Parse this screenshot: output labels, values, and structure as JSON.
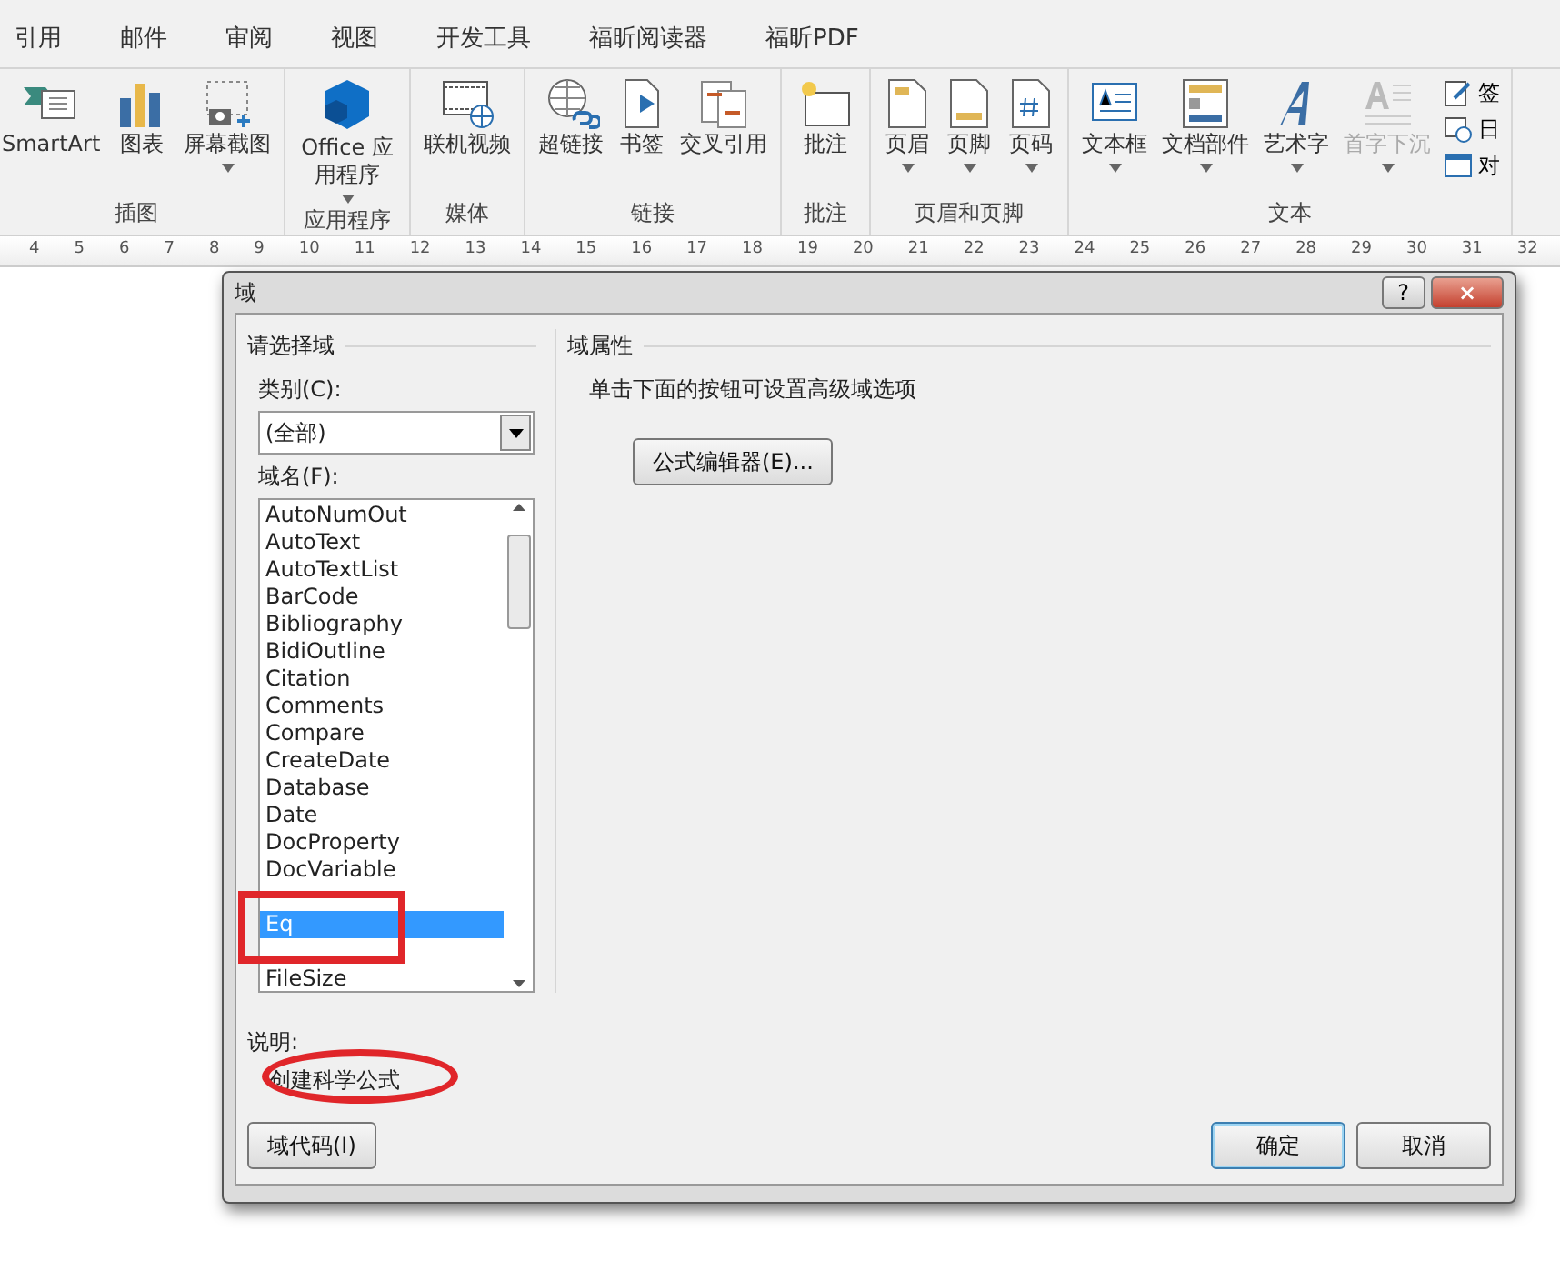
{
  "ribbon": {
    "tabs": [
      {
        "label": "引用",
        "selected": false
      },
      {
        "label": "邮件",
        "selected": false
      },
      {
        "label": "审阅",
        "selected": false
      },
      {
        "label": "视图",
        "selected": false
      },
      {
        "label": "开发工具",
        "selected": false
      },
      {
        "label": "福昕阅读器",
        "selected": false
      },
      {
        "label": "福昕PDF",
        "selected": false
      }
    ],
    "groups": [
      {
        "label": "插图",
        "buttons": [
          {
            "kind": "smartart",
            "label": "SmartArt",
            "dropdown": false,
            "disabled": false
          },
          {
            "kind": "chart",
            "label": "图表",
            "dropdown": false,
            "disabled": false
          },
          {
            "kind": "screenshot",
            "label": "屏幕截图",
            "dropdown": true,
            "disabled": false
          }
        ]
      },
      {
        "label": "应用程序",
        "buttons": [
          {
            "kind": "addin",
            "label": "Office 应用程序",
            "dropdown": true,
            "disabled": false
          }
        ]
      },
      {
        "label": "媒体",
        "buttons": [
          {
            "kind": "video",
            "label": "联机视频",
            "dropdown": false,
            "disabled": false
          }
        ]
      },
      {
        "label": "链接",
        "buttons": [
          {
            "kind": "hyperlink",
            "label": "超链接",
            "dropdown": false,
            "disabled": false
          },
          {
            "kind": "bookmark",
            "label": "书签",
            "dropdown": false,
            "disabled": false
          },
          {
            "kind": "crossref",
            "label": "交叉引用",
            "dropdown": false,
            "disabled": false
          }
        ]
      },
      {
        "label": "批注",
        "buttons": [
          {
            "kind": "comment",
            "label": "批注",
            "dropdown": false,
            "disabled": false
          }
        ]
      },
      {
        "label": "页眉和页脚",
        "buttons": [
          {
            "kind": "header",
            "label": "页眉",
            "dropdown": true,
            "disabled": false
          },
          {
            "kind": "footer",
            "label": "页脚",
            "dropdown": true,
            "disabled": false
          },
          {
            "kind": "pagenumber",
            "label": "页码",
            "dropdown": true,
            "disabled": false
          }
        ]
      },
      {
        "label": "文本",
        "buttons": [
          {
            "kind": "textbox",
            "label": "文本框",
            "dropdown": true,
            "disabled": false
          },
          {
            "kind": "parts",
            "label": "文档部件",
            "dropdown": true,
            "disabled": false
          },
          {
            "kind": "wordart",
            "label": "艺术字",
            "dropdown": true,
            "disabled": false
          },
          {
            "kind": "dropcap",
            "label": "首字下沉",
            "dropdown": true,
            "disabled": true
          }
        ],
        "small_buttons": [
          {
            "kind": "signature",
            "label": "签"
          },
          {
            "kind": "datetime",
            "label": "日"
          },
          {
            "kind": "object",
            "label": "对"
          }
        ]
      }
    ]
  },
  "ruler": {
    "numbers": [
      "4",
      "5",
      "6",
      "7",
      "8",
      "9",
      "10",
      "11",
      "12",
      "13",
      "14",
      "15",
      "16",
      "17",
      "18",
      "19",
      "20",
      "21",
      "22",
      "23",
      "24",
      "25",
      "26",
      "27",
      "28",
      "29",
      "30",
      "31",
      "32"
    ]
  },
  "dialog": {
    "title": "域",
    "help": "?",
    "close": "×",
    "left_group": {
      "title": "请选择域",
      "category_label": "类别(C):",
      "category_value": "(全部)",
      "field_names_label": "域名(F):",
      "field_names": [
        {
          "label": "AutoNumOut",
          "selected": false
        },
        {
          "label": "AutoText",
          "selected": false
        },
        {
          "label": "AutoTextList",
          "selected": false
        },
        {
          "label": "BarCode",
          "selected": false
        },
        {
          "label": "Bibliography",
          "selected": false
        },
        {
          "label": "BidiOutline",
          "selected": false
        },
        {
          "label": "Citation",
          "selected": false
        },
        {
          "label": "Comments",
          "selected": false
        },
        {
          "label": "Compare",
          "selected": false
        },
        {
          "label": "CreateDate",
          "selected": false
        },
        {
          "label": "Database",
          "selected": false
        },
        {
          "label": "Date",
          "selected": false
        },
        {
          "label": "DocProperty",
          "selected": false
        },
        {
          "label": "DocVariable",
          "selected": false
        },
        {
          "label": "Eq",
          "selected": true
        },
        {
          "label": "FileSize",
          "selected": false
        }
      ]
    },
    "right_group": {
      "title": "域属性",
      "hint": "单击下面的按钮可设置高级域选项",
      "button": "公式编辑器(E)..."
    },
    "description_label": "说明:",
    "description": "创建科学公式",
    "field_codes_button": "域代码(I)",
    "buttons": [
      {
        "label": "确定",
        "default": true
      },
      {
        "label": "取消",
        "default": false
      }
    ]
  }
}
